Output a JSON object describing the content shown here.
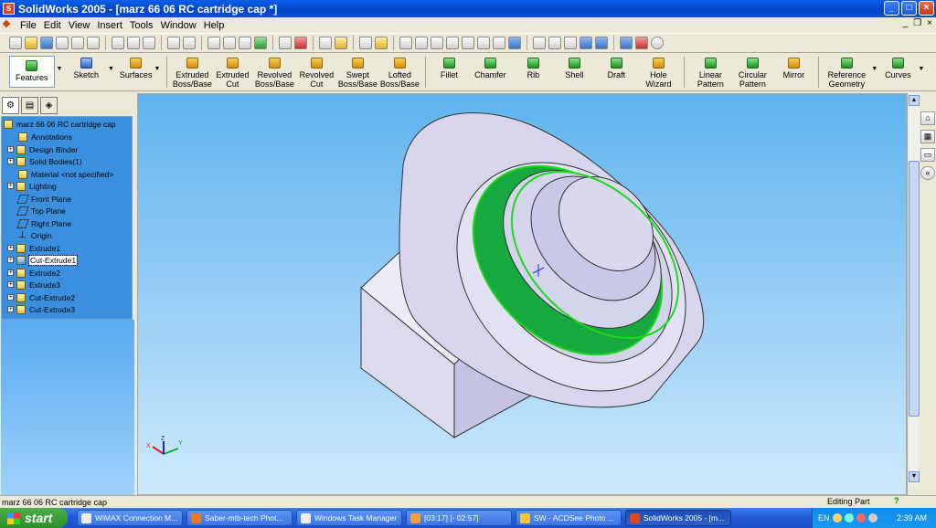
{
  "window": {
    "title": "SolidWorks 2005 - [marz 66 06 RC cartridge cap *]",
    "min": "_",
    "max": "□",
    "close": "×"
  },
  "menu": {
    "items": [
      "File",
      "Edit",
      "View",
      "Insert",
      "Tools",
      "Window",
      "Help"
    ]
  },
  "command_manager": {
    "items": [
      {
        "label": "Features",
        "selected": true
      },
      {
        "label": "Sketch",
        "selected": false
      },
      {
        "label": "Surfaces",
        "selected": false
      },
      {
        "label": "Extruded Boss/Base"
      },
      {
        "label": "Extruded Cut"
      },
      {
        "label": "Revolved Boss/Base"
      },
      {
        "label": "Revolved Cut"
      },
      {
        "label": "Swept Boss/Base"
      },
      {
        "label": "Lofted Boss/Base"
      },
      {
        "label": "Fillet"
      },
      {
        "label": "Chamfer"
      },
      {
        "label": "Rib"
      },
      {
        "label": "Shell"
      },
      {
        "label": "Draft"
      },
      {
        "label": "Hole Wizard"
      },
      {
        "label": "Linear Pattern"
      },
      {
        "label": "Circular Pattern"
      },
      {
        "label": "Mirror"
      },
      {
        "label": "Reference Geometry"
      },
      {
        "label": "Curves"
      }
    ]
  },
  "feature_tree": {
    "root": "marz 66 06 RC cartridge cap",
    "items": [
      {
        "label": "Annotations",
        "expandable": false
      },
      {
        "label": "Design Binder",
        "expandable": true
      },
      {
        "label": "Solid Bodies(1)",
        "expandable": true
      },
      {
        "label": "Material <not specified>",
        "expandable": false
      },
      {
        "label": "Lighting",
        "expandable": true
      },
      {
        "label": "Front Plane",
        "expandable": false
      },
      {
        "label": "Top Plane",
        "expandable": false
      },
      {
        "label": "Right Plane",
        "expandable": false
      },
      {
        "label": "Origin",
        "expandable": false
      },
      {
        "label": "Extrude1",
        "expandable": true
      },
      {
        "label": "Cut-Extrude1",
        "expandable": true,
        "selected": true
      },
      {
        "label": "Extrude2",
        "expandable": true
      },
      {
        "label": "Extrude3",
        "expandable": true
      },
      {
        "label": "Cut-Extrude2",
        "expandable": true
      },
      {
        "label": "Cut-Extrude3",
        "expandable": true
      }
    ]
  },
  "triad": {
    "x": "X",
    "y": "Y",
    "z": "Z"
  },
  "status": {
    "left": "marz 66 06 RC cartridge cap",
    "mode": "Editing Part",
    "help": "?"
  },
  "taskbar": {
    "start": "start",
    "tasks": [
      "WiMAX Connection M...",
      "Saber-mtb-tech Phot...",
      "Windows Task Manager",
      "[03:17] [- 02:57]",
      "SW - ACDSee Photo ...",
      "SolidWorks 2005 - [m..."
    ],
    "lang": "EN",
    "clock": "2:39 AM"
  },
  "colors": {
    "selection_green": "#17a93f",
    "model_face": "#d7d6ee",
    "viewport_top": "#5fb4ef"
  }
}
